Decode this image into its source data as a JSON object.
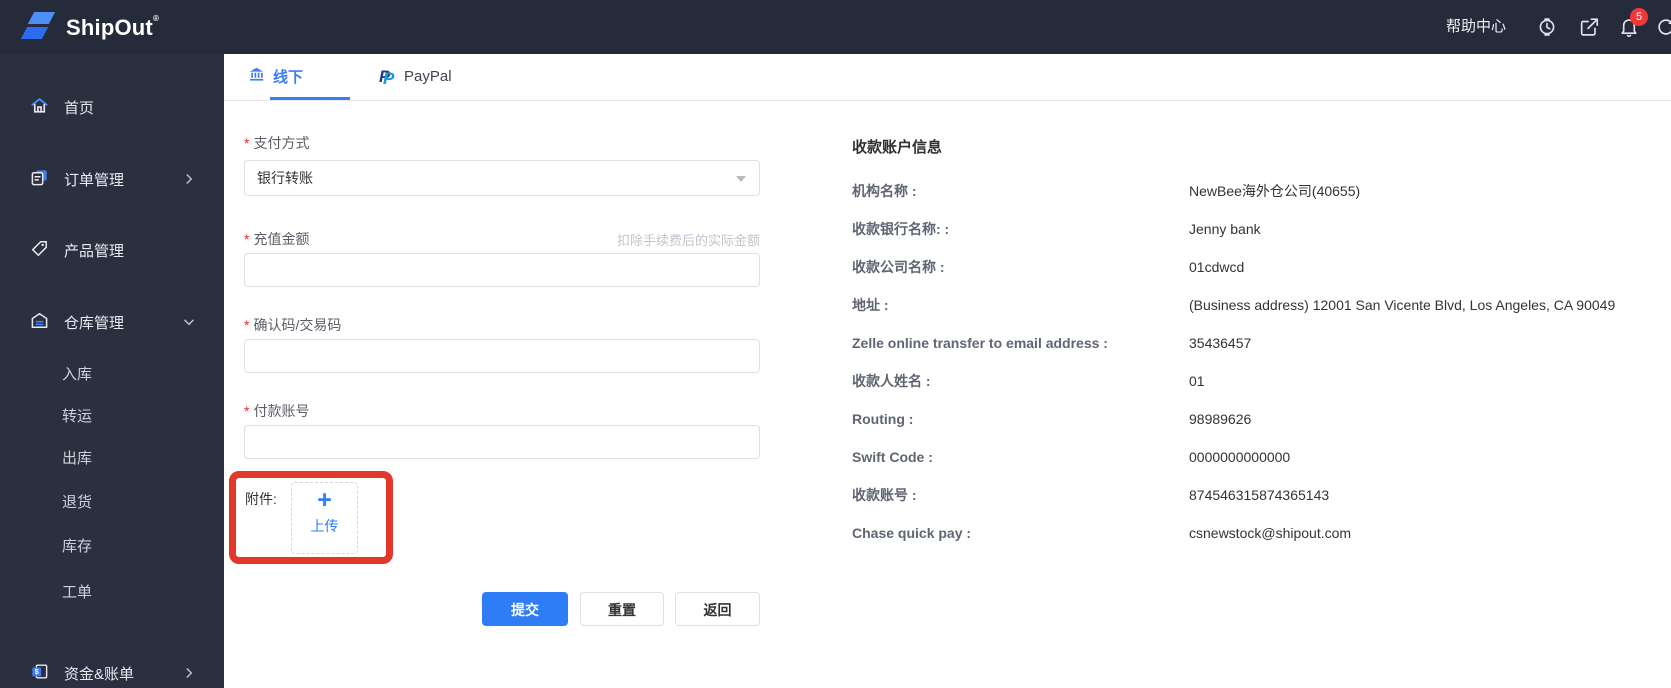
{
  "navbar": {
    "brand": "ShipOut",
    "help_center": "帮助中心",
    "notification_count": "5"
  },
  "sidebar": {
    "items": [
      {
        "label": "首页",
        "icon": "home-icon"
      },
      {
        "label": "订单管理",
        "icon": "orders-icon",
        "chevron": "right"
      },
      {
        "label": "产品管理",
        "icon": "tag-icon"
      },
      {
        "label": "仓库管理",
        "icon": "warehouse-icon",
        "chevron": "down"
      },
      {
        "label": "资金&账单",
        "icon": "funds-icon",
        "chevron": "right"
      }
    ],
    "warehouse_sub_items": [
      {
        "label": "入库"
      },
      {
        "label": "转运"
      },
      {
        "label": "出库"
      },
      {
        "label": "退货"
      },
      {
        "label": "库存"
      },
      {
        "label": "工单"
      }
    ]
  },
  "tabs": {
    "offline": "线下",
    "paypal": "PayPal"
  },
  "form": {
    "required_marker": "*",
    "payment_method_label": "支付方式",
    "payment_method_value": "银行转账",
    "amount_label": "充值金额",
    "amount_hint": "扣除手续费后的实际金额",
    "confirmation_label": "确认码/交易码",
    "payer_account_label": "付款账号",
    "attachment_label": "附件:",
    "upload_plus": "+",
    "upload_label": "上传",
    "submit_label": "提交",
    "reset_label": "重置",
    "back_label": "返回"
  },
  "info_panel": {
    "title": "收款账户信息",
    "rows": [
      {
        "label": "机构名称 :",
        "value": "NewBee海外仓公司(40655)"
      },
      {
        "label": "收款银行名称: :",
        "value": "Jenny bank"
      },
      {
        "label": "收款公司名称 :",
        "value": "01cdwcd"
      },
      {
        "label": "地址 :",
        "value": "(Business address) 12001 San Vicente Blvd, Los Angeles, CA 90049"
      },
      {
        "label": "Zelle online transfer to email address :",
        "value": "35436457"
      },
      {
        "label": "收款人姓名 :",
        "value": "01"
      },
      {
        "label": "Routing :",
        "value": "98989626"
      },
      {
        "label": "Swift Code :",
        "value": "0000000000000"
      },
      {
        "label": "收款账号 :",
        "value": "874546315874365143"
      },
      {
        "label": "Chase quick pay :",
        "value": "csnewstock@shipout.com"
      }
    ]
  },
  "colors": {
    "accent_blue": "#2e7cf6",
    "navbar_bg": "#252b3a",
    "sidebar_bg": "#2a3040",
    "annotation_red": "#e2382a",
    "badge_red": "#f0383b",
    "required_red": "#f5222d"
  }
}
